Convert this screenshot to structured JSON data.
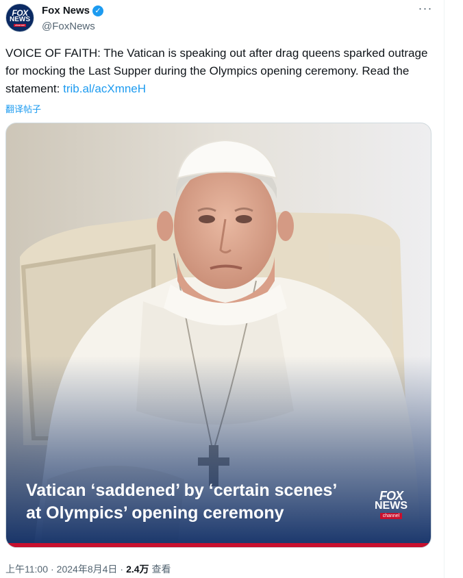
{
  "author": {
    "name": "Fox News",
    "handle": "@FoxNews",
    "verified": true,
    "avatar_logo": {
      "top": "FOX",
      "middle": "NEWS",
      "bottom": "channel"
    }
  },
  "menu_icon": "more-horizontal-icon",
  "tweet": {
    "text": "VOICE OF FAITH: The Vatican is speaking out after drag queens sparked outrage for mocking the Last Supper during the Olympics opening ceremony. Read the statement: ",
    "link": "trib.al/acXmneH",
    "translate_label": "翻译帖子"
  },
  "media": {
    "headline_line1": "Vatican ‘saddened’ by ‘certain scenes’",
    "headline_line2": "at Olympics’ opening ceremony",
    "badge": {
      "top": "FOX",
      "middle": "NEWS",
      "bottom": "channel"
    }
  },
  "footer": {
    "time": "上午11:00",
    "separator1": "·",
    "date": "2024年8月4日",
    "separator2": "·",
    "views": "2.4万",
    "views_label": "查看"
  },
  "colors": {
    "link": "#1d9bf0",
    "secondary_text": "#536471",
    "fox_navy": "#0b2a63",
    "fox_red": "#c8102e"
  }
}
